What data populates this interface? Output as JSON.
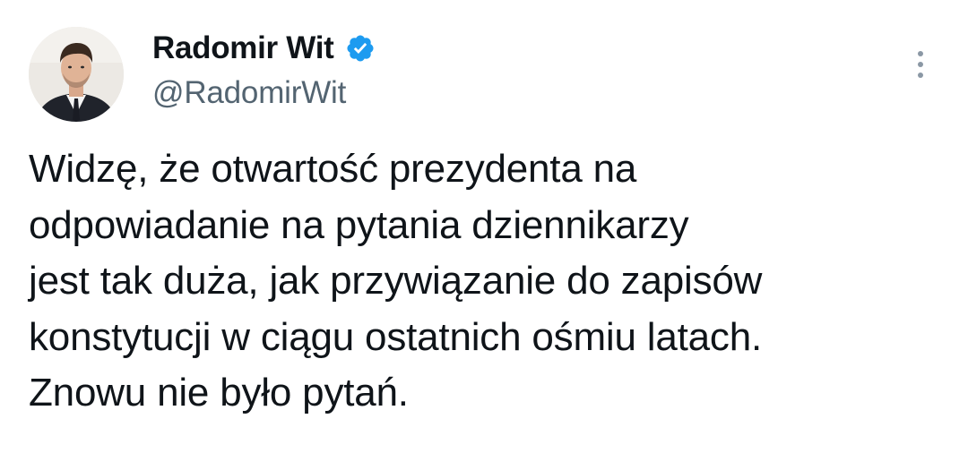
{
  "author": {
    "display_name": "Radomir Wit",
    "handle": "@RadomirWit",
    "verified_icon": "verified-badge-icon",
    "avatar_icon": "avatar-photo"
  },
  "actions": {
    "more_icon": "more-options-icon"
  },
  "tweet": {
    "lines": [
      "Widzę, że otwartość prezydenta na",
      "odpowiadanie na pytania dziennikarzy",
      "jest tak duża, jak przywiązanie do zapisów",
      "konstytucji w ciągu ostatnich ośmiu latach.",
      "Znowu nie było pytań."
    ]
  },
  "colors": {
    "text": "#0f1419",
    "secondary_text": "#536471",
    "verified_blue": "#1d9bf0",
    "background": "#ffffff"
  }
}
